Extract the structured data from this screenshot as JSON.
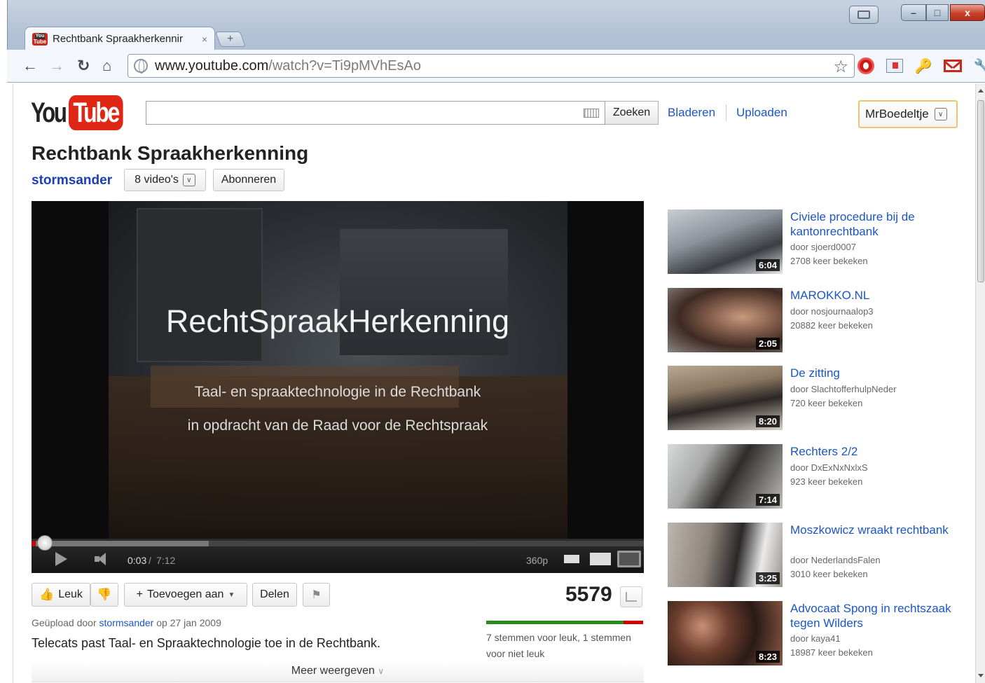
{
  "browser": {
    "tab_title": "Rechtbank Spraakherkennir",
    "tab_close": "×",
    "new_tab": "+",
    "url_domain": "www.youtube.com",
    "url_path": "/watch?v=Ti9pMVhEsAo",
    "window_buttons": {
      "minimize": "–",
      "maximize": "□",
      "close": "x"
    }
  },
  "youtube": {
    "logo_you": "You",
    "logo_tube": "Tube",
    "search_button": "Zoeken",
    "search_value": "",
    "nav_browse": "Bladeren",
    "nav_upload": "Uploaden",
    "user_name": "MrBoedeltje"
  },
  "video": {
    "title": "Rechtbank Spraakherkenning",
    "channel": "stormsander",
    "video_count": "8 video's",
    "subscribe": "Abonneren",
    "overlay_title": "RechtSpraakHerkenning",
    "overlay_line1": "Taal- en spraaktechnologie in de Rechtbank",
    "overlay_line2": "in opdracht van de Raad voor de Rechtspraak",
    "time_current": "0:03",
    "time_separator": "/",
    "time_duration": "7:12",
    "quality": "360p",
    "progress_played": 0.007,
    "progress_buffered": 0.29,
    "like": "Leuk",
    "add_to": "Toevoegen aan",
    "share": "Delen",
    "views": "5579",
    "like_ratio": 0.875,
    "vote_summary": "7 stemmen voor leuk, 1 stemmen voor niet leuk",
    "uploaded_prefix": "Geüpload door",
    "uploader": "stormsander",
    "uploaded_date": "op 27 jan 2009",
    "description": "Telecats past Taal- en Spraaktechnologie toe in de Rechtbank.",
    "show_more": "Meer weergeven"
  },
  "related": [
    {
      "title": "Civiele procedure bij de kantonrechtbank",
      "by": "door sjoerd0007",
      "views": "2708 keer bekeken",
      "duration": "6:04"
    },
    {
      "title": "MAROKKO.NL",
      "by": "door nosjournaalop3",
      "views": "20882 keer bekeken",
      "duration": "2:05"
    },
    {
      "title": "De zitting",
      "by": "door SlachtofferhulpNeder",
      "views": "720 keer bekeken",
      "duration": "8:20"
    },
    {
      "title": "Rechters 2/2",
      "by": "door DxExNxNxlxS",
      "views": "923 keer bekeken",
      "duration": "7:14"
    },
    {
      "title": "Moszkowicz wraakt rechtbank",
      "by": "door NederlandsFalen",
      "views": "3010 keer bekeken",
      "duration": "3:25"
    },
    {
      "title": "Advocaat Spong in rechtszaak tegen Wilders",
      "by": "door kaya41",
      "views": "18987 keer bekeken",
      "duration": "8:23"
    }
  ],
  "colors": {
    "youtube_red": "#e02716",
    "link_blue": "#1a56c7",
    "like_green": "#2a8a1e",
    "dislike_red": "#cc0000"
  }
}
